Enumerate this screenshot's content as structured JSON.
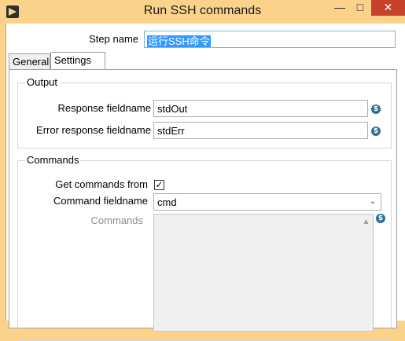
{
  "window": {
    "title": "Run SSH commands",
    "minimize_glyph": "—",
    "maximize_glyph": "□",
    "close_glyph": "✕"
  },
  "step": {
    "label": "Step name",
    "value": "运行SSH命令"
  },
  "tabs": [
    {
      "label": "General",
      "active": false
    },
    {
      "label": "Settings",
      "active": true
    }
  ],
  "output": {
    "group_title": "Output",
    "response_label": "Response fieldname",
    "response_value": "stdOut",
    "error_label": "Error response fieldname",
    "error_value": "stdErr"
  },
  "commands": {
    "group_title": "Commands",
    "get_from_label": "Get commands from",
    "get_from_checked": true,
    "checkbox_glyph": "✓",
    "fieldname_label": "Command fieldname",
    "fieldname_value": "cmd",
    "commands_label": "Commands",
    "commands_value": ""
  },
  "icons": {
    "variable_icon_glyph": "$",
    "dropdown_glyph": "⌄",
    "scroll_up_glyph": "▲"
  }
}
